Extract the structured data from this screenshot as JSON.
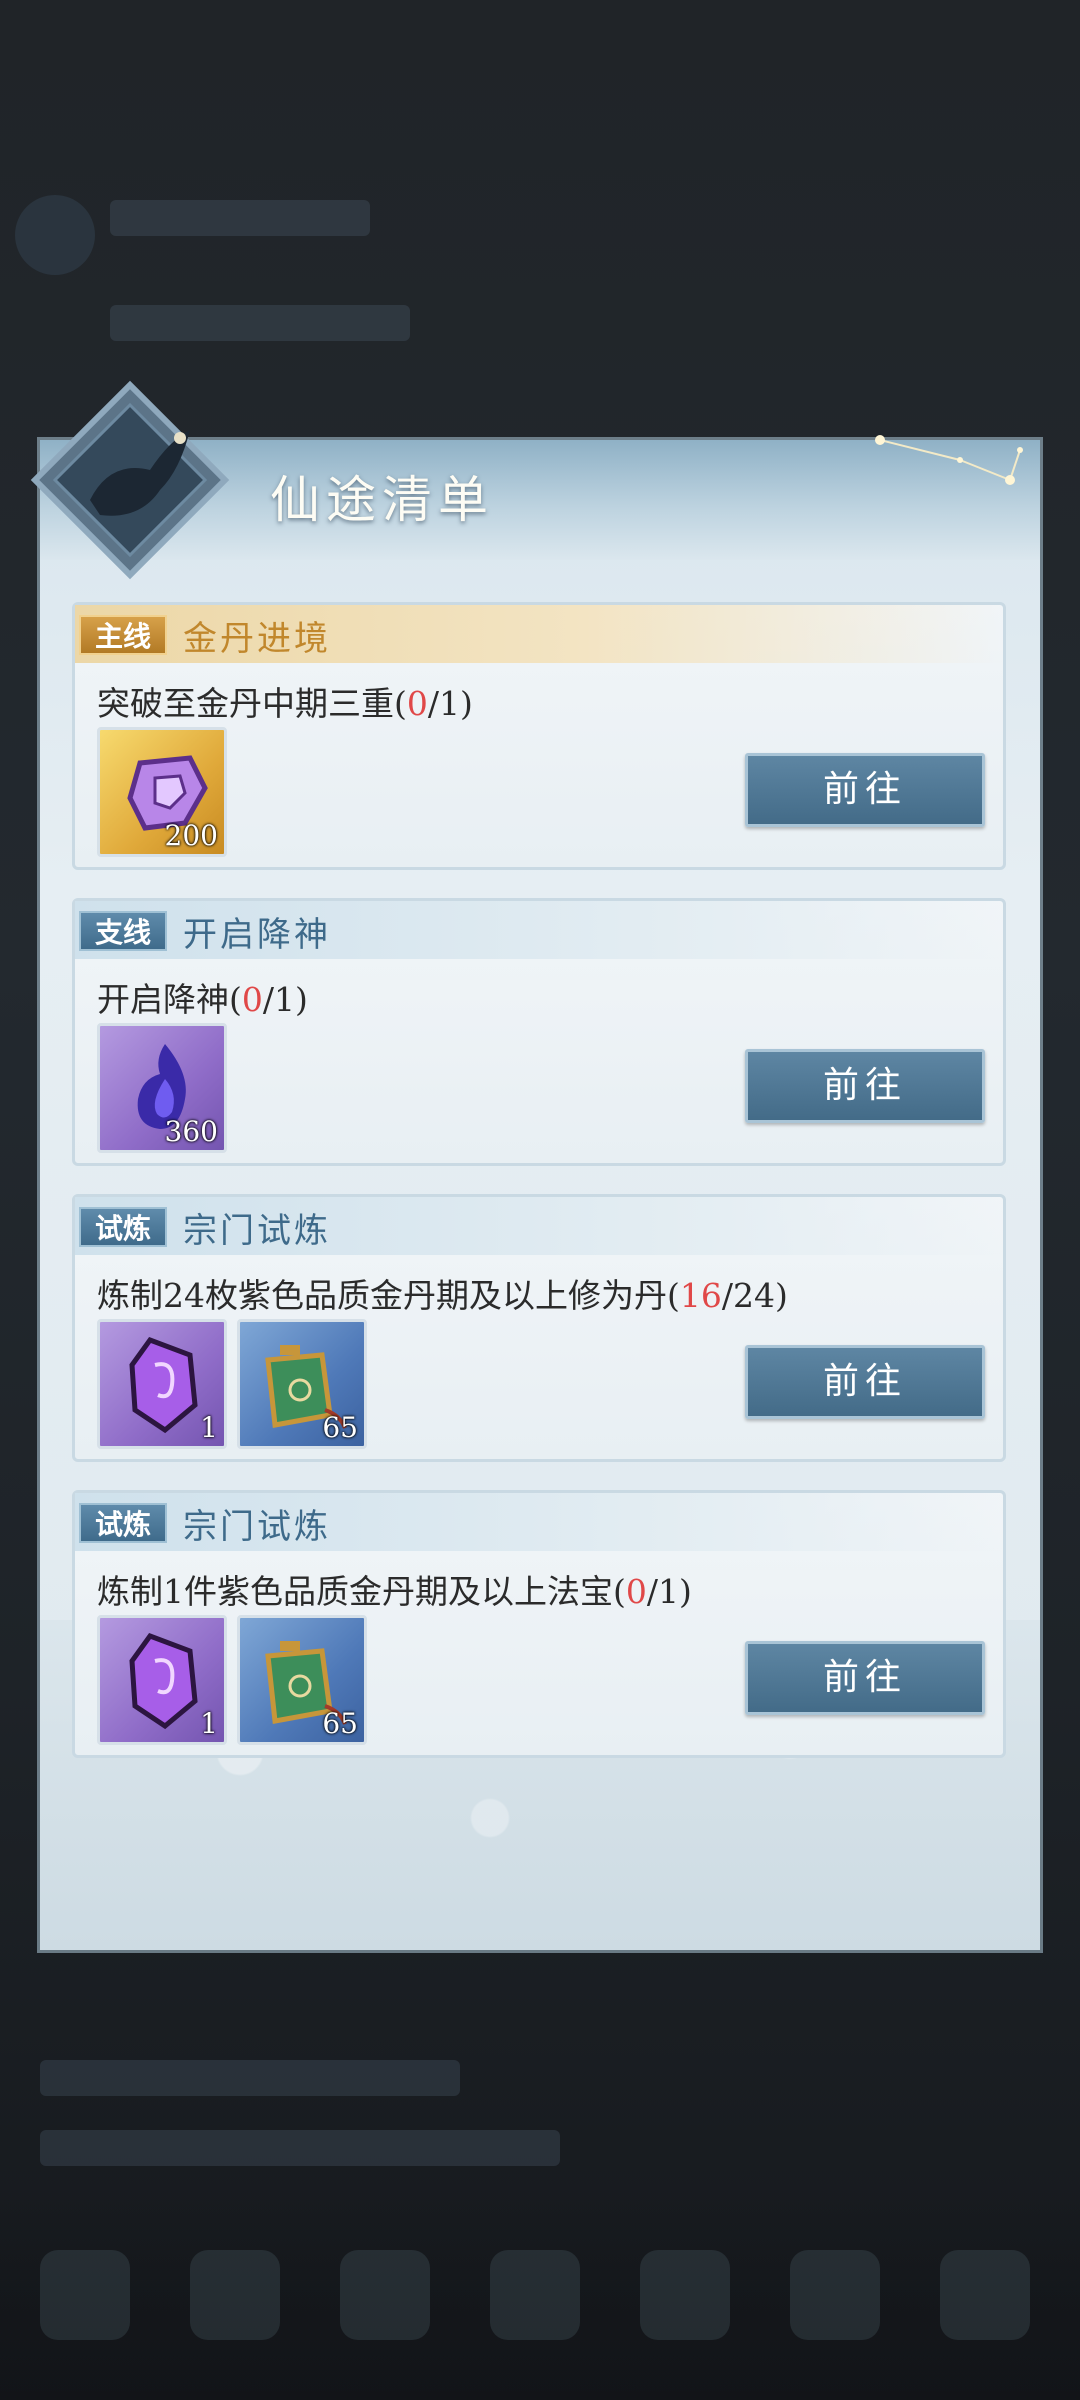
{
  "panel": {
    "title": "仙途清单"
  },
  "quests": [
    {
      "tag": "主线",
      "title": "金丹进境",
      "desc": "突破至金丹中期三重",
      "progress_done": "0",
      "progress_total": "1",
      "rewards": [
        {
          "icon": "lingshi-crystal-icon",
          "qty": "200"
        }
      ],
      "button": "前往"
    },
    {
      "tag": "支线",
      "title": "开启降神",
      "desc": "开启降神",
      "progress_done": "0",
      "progress_total": "1",
      "rewards": [
        {
          "icon": "purple-flame-icon",
          "qty": "360"
        }
      ],
      "button": "前往"
    },
    {
      "tag": "试炼",
      "title": "宗门试炼",
      "desc": "炼制24枚紫色品质金丹期及以上修为丹",
      "progress_done": "16",
      "progress_total": "24",
      "rewards": [
        {
          "icon": "purple-gem-icon",
          "qty": "1"
        },
        {
          "icon": "jade-talisman-icon",
          "qty": "65"
        }
      ],
      "button": "前往"
    },
    {
      "tag": "试炼",
      "title": "宗门试炼",
      "desc": "炼制1件紫色品质金丹期及以上法宝",
      "progress_done": "0",
      "progress_total": "1",
      "rewards": [
        {
          "icon": "purple-gem-icon",
          "qty": "1"
        },
        {
          "icon": "jade-talisman-icon",
          "qty": "65"
        }
      ],
      "button": "前往"
    }
  ],
  "colors": {
    "progress_done": "#e04848",
    "main_accent": "#c1872c",
    "side_accent": "#3e6a8a"
  }
}
